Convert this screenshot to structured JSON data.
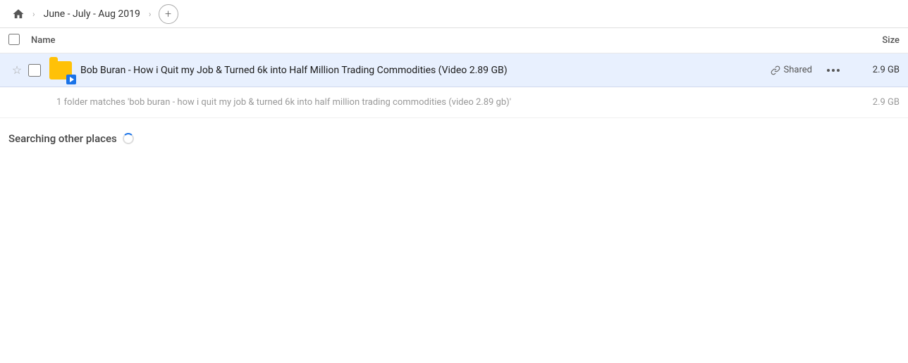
{
  "breadcrumb": {
    "home_icon": "⌂",
    "sep1": "›",
    "item1": "June - July - Aug 2019",
    "sep2": "›",
    "add_icon": "+"
  },
  "columns": {
    "name_label": "Name",
    "size_label": "Size"
  },
  "file_row": {
    "star_icon": "☆",
    "file_name": "Bob Buran - How i Quit my Job & Turned 6k into Half Million Trading Commodities (Video 2.89 GB)",
    "shared_label": "Shared",
    "more_icon": "•••",
    "size": "2.9 GB",
    "link_icon": "🔗"
  },
  "subfolder_row": {
    "text": "1 folder matches 'bob buran - how i quit my job & turned 6k into half million trading commodities (video 2.89 gb)'",
    "size": "2.9 GB"
  },
  "searching": {
    "label": "Searching other places"
  },
  "colors": {
    "row_highlight": "#e8f0fe",
    "accent": "#1a73e8"
  }
}
